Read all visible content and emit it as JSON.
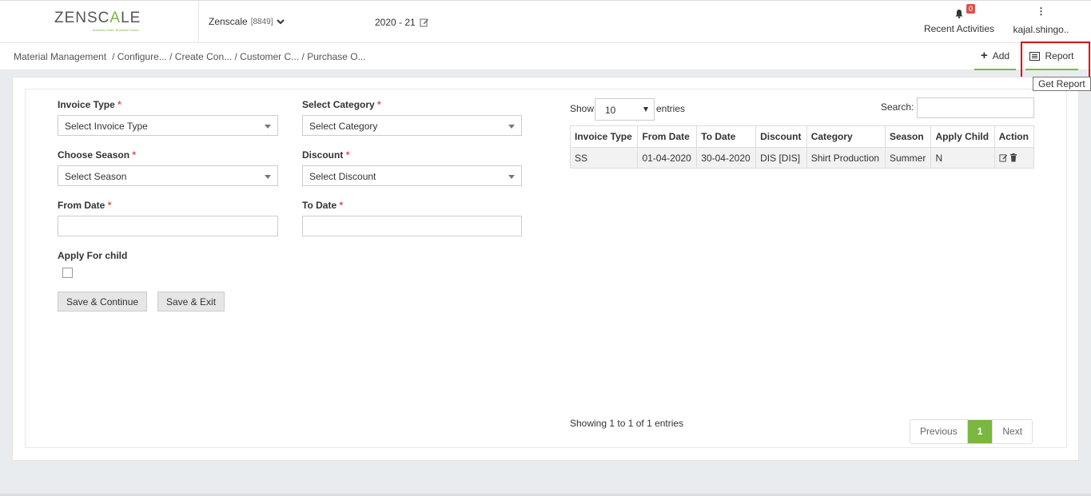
{
  "header": {
    "logo": {
      "text_left": "ZENSC",
      "text_accent": "A",
      "text_right": "LE",
      "tagline": "Business Ease. Business Peace."
    },
    "company": {
      "name": "Zenscale",
      "code": "[8849]"
    },
    "fiscal_year": "2020 - 21",
    "notifications": {
      "count": "0",
      "label": "Recent Activities"
    },
    "user": {
      "name": "kajal.shingo.."
    }
  },
  "breadcrumb": {
    "items": [
      "Material Management",
      "/ Configure...",
      "/ Create Con...",
      "/ Customer C...",
      "/ Purchase O..."
    ]
  },
  "toolbar": {
    "add_label": "Add",
    "report_label": "Report",
    "report_tooltip": "Get Report"
  },
  "form": {
    "invoice_type": {
      "label": "Invoice Type",
      "value": "Select Invoice Type"
    },
    "select_category": {
      "label": "Select Category",
      "value": "Select Category"
    },
    "choose_season": {
      "label": "Choose Season",
      "value": "Select Season"
    },
    "discount": {
      "label": "Discount",
      "value": "Select Discount"
    },
    "from_date": {
      "label": "From Date",
      "value": ""
    },
    "to_date": {
      "label": "To Date",
      "value": ""
    },
    "apply_for_child": {
      "label": "Apply For child",
      "checked": false
    },
    "required_mark": "*",
    "save_continue_label": "Save & Continue",
    "save_exit_label": "Save & Exit"
  },
  "table": {
    "show_label": "Show",
    "page_size": "10",
    "entries_label": "entries",
    "search_label": "Search:",
    "columns": [
      "Invoice Type",
      "From Date",
      "To Date",
      "Discount",
      "Category",
      "Season",
      "Apply Child",
      "Action"
    ],
    "rows": [
      {
        "invoice_type": "SS",
        "from_date": "01-04-2020",
        "to_date": "30-04-2020",
        "discount": "DIS [DIS]",
        "category": "Shirt Production",
        "season": "Summer",
        "apply_child": "N"
      }
    ],
    "info": "Showing 1 to 1 of 1 entries",
    "pagination": {
      "previous": "Previous",
      "current": "1",
      "next": "Next"
    }
  },
  "colors": {
    "accent": "#79b73e",
    "required": "#d9534f",
    "highlight": "#e00000"
  }
}
